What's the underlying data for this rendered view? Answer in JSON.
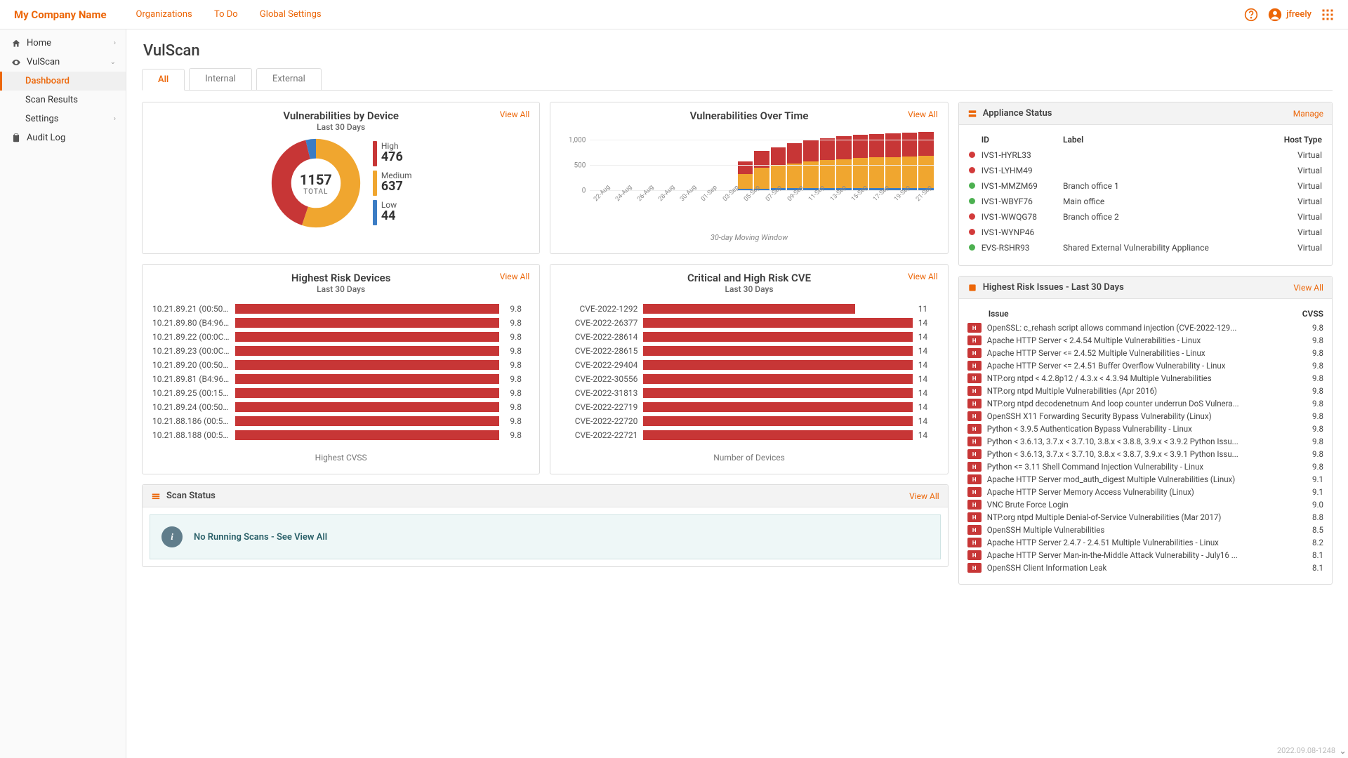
{
  "brand": "My Company Name",
  "topnav": {
    "organizations": "Organizations",
    "todo": "To Do",
    "global": "Global Settings"
  },
  "user": "jfreely",
  "sidebar": {
    "home": "Home",
    "vulscan": "VulScan",
    "dashboard": "Dashboard",
    "scan_results": "Scan Results",
    "settings": "Settings",
    "audit_log": "Audit Log"
  },
  "page_title": "VulScan",
  "tabs": {
    "all": "All",
    "internal": "Internal",
    "external": "External"
  },
  "view_all": "View All",
  "manage": "Manage",
  "donut": {
    "title": "Vulnerabilities by Device",
    "subtitle": "Last 30 Days",
    "total_label": "TOTAL",
    "total": "1157",
    "high_label": "High",
    "high": "476",
    "med_label": "Medium",
    "med": "637",
    "low_label": "Low",
    "low": "44",
    "colors": {
      "high": "#c73636",
      "med": "#f0a62f",
      "low": "#3b7cc4"
    }
  },
  "overtime": {
    "title": "Vulnerabilities Over Time",
    "subtitle": "30-day Moving Window",
    "ylim": 1300
  },
  "chart_data": {
    "type": "bar",
    "title": "Vulnerabilities Over Time",
    "subtitle": "30-day Moving Window",
    "ylabel": "",
    "y_ticks": [
      0,
      500,
      1000
    ],
    "ylim": [
      0,
      1300
    ],
    "categories": [
      "22-Aug",
      "24-Aug",
      "26-Aug",
      "28-Aug",
      "30-Aug",
      "01-Sep",
      "03-Sep",
      "05-Sep",
      "07-Sep",
      "09-Sep",
      "11-Sep",
      "13-Sep",
      "15-Sep",
      "17-Sep",
      "19-Sep",
      "21-Sep"
    ],
    "series": [
      {
        "name": "Low",
        "color": "#3b7cc4",
        "values": [
          0,
          0,
          0,
          0,
          0,
          0,
          0,
          0,
          0,
          28,
          32,
          36,
          36,
          40,
          40,
          42,
          42,
          44,
          44,
          44,
          44
        ]
      },
      {
        "name": "Medium",
        "color": "#f0a62f",
        "values": [
          0,
          0,
          0,
          0,
          0,
          0,
          0,
          0,
          0,
          300,
          420,
          460,
          500,
          540,
          560,
          580,
          600,
          610,
          620,
          630,
          637
        ]
      },
      {
        "name": "High",
        "color": "#c73636",
        "values": [
          0,
          0,
          0,
          0,
          0,
          0,
          0,
          0,
          0,
          240,
          330,
          360,
          400,
          420,
          440,
          450,
          460,
          464,
          468,
          472,
          476
        ]
      }
    ]
  },
  "risk_devices": {
    "title": "Highest Risk Devices",
    "subtitle": "Last 30 Days",
    "axis": "Highest CVSS",
    "rows": [
      {
        "label": "10.21.89.21 (00:50:5...",
        "v": "9.8"
      },
      {
        "label": "10.21.89.80 (B4:96:9...",
        "v": "9.8"
      },
      {
        "label": "10.21.89.22 (00:0C:2...",
        "v": "9.8"
      },
      {
        "label": "10.21.89.23 (00:0C:2...",
        "v": "9.8"
      },
      {
        "label": "10.21.89.20 (00:50:5...",
        "v": "9.8"
      },
      {
        "label": "10.21.89.81 (B4:96:9...",
        "v": "9.8"
      },
      {
        "label": "10.21.89.25 (00:15:5...",
        "v": "9.8"
      },
      {
        "label": "10.21.89.24 (00:50:5...",
        "v": "9.8"
      },
      {
        "label": "10.21.88.186 (00:50:...",
        "v": "9.8"
      },
      {
        "label": "10.21.88.188 (00:50:...",
        "v": "9.8"
      }
    ]
  },
  "cve": {
    "title": "Critical and High Risk CVE",
    "subtitle": "Last 30 Days",
    "axis": "Number of Devices",
    "max": 14,
    "rows": [
      {
        "label": "CVE-2022-1292",
        "v": "11"
      },
      {
        "label": "CVE-2022-26377",
        "v": "14"
      },
      {
        "label": "CVE-2022-28614",
        "v": "14"
      },
      {
        "label": "CVE-2022-28615",
        "v": "14"
      },
      {
        "label": "CVE-2022-29404",
        "v": "14"
      },
      {
        "label": "CVE-2022-30556",
        "v": "14"
      },
      {
        "label": "CVE-2022-31813",
        "v": "14"
      },
      {
        "label": "CVE-2022-22719",
        "v": "14"
      },
      {
        "label": "CVE-2022-22720",
        "v": "14"
      },
      {
        "label": "CVE-2022-22721",
        "v": "14"
      }
    ]
  },
  "appliance": {
    "title": "Appliance Status",
    "cols": {
      "id": "ID",
      "label": "Label",
      "host": "Host Type"
    },
    "rows": [
      {
        "dot": "#d23a3a",
        "id": "IVS1-HYRL33",
        "label": "",
        "host": "Virtual"
      },
      {
        "dot": "#d23a3a",
        "id": "IVS1-LYHM49",
        "label": "",
        "host": "Virtual"
      },
      {
        "dot": "#4cb050",
        "id": "IVS1-MMZM69",
        "label": "Branch office 1",
        "host": "Virtual"
      },
      {
        "dot": "#4cb050",
        "id": "IVS1-WBYF76",
        "label": "Main office",
        "host": "Virtual"
      },
      {
        "dot": "#d23a3a",
        "id": "IVS1-WWQG78",
        "label": "Branch office 2",
        "host": "Virtual"
      },
      {
        "dot": "#d23a3a",
        "id": "IVS1-WYNP46",
        "label": "",
        "host": "Virtual"
      },
      {
        "dot": "#4cb050",
        "id": "EVS-RSHR93",
        "label": "Shared External Vulnerability Appliance",
        "host": "Virtual"
      }
    ]
  },
  "issues": {
    "title": "Highest Risk Issues - Last 30 Days",
    "cols": {
      "issue": "Issue",
      "cvss": "CVSS"
    },
    "rows": [
      {
        "t": "OpenSSL: c_rehash script allows command injection (CVE-2022-129...",
        "s": "9.8"
      },
      {
        "t": "Apache HTTP Server < 2.4.54 Multiple Vulnerabilities - Linux",
        "s": "9.8"
      },
      {
        "t": "Apache HTTP Server <= 2.4.52 Multiple Vulnerabilities - Linux",
        "s": "9.8"
      },
      {
        "t": "Apache HTTP Server <= 2.4.51 Buffer Overflow Vulnerability - Linux",
        "s": "9.8"
      },
      {
        "t": "NTP.org ntpd < 4.2.8p12 / 4.3.x < 4.3.94 Multiple Vulnerabilities",
        "s": "9.8"
      },
      {
        "t": "NTP.org ntpd Multiple Vulnerabilities (Apr 2016)",
        "s": "9.8"
      },
      {
        "t": "NTP.org ntpd decodenetnum And loop counter underrun DoS Vulnera...",
        "s": "9.8"
      },
      {
        "t": "OpenSSH X11 Forwarding Security Bypass Vulnerability (Linux)",
        "s": "9.8"
      },
      {
        "t": "Python < 3.9.5 Authentication Bypass Vulnerability - Linux",
        "s": "9.8"
      },
      {
        "t": "Python < 3.6.13, 3.7.x < 3.7.10, 3.8.x < 3.8.8, 3.9.x < 3.9.2 Python Issu...",
        "s": "9.8"
      },
      {
        "t": "Python < 3.6.13, 3.7.x < 3.7.10, 3.8.x < 3.8.7, 3.9.x < 3.9.1 Python Issu...",
        "s": "9.8"
      },
      {
        "t": "Python <= 3.11 Shell Command Injection Vulnerability - Linux",
        "s": "9.8"
      },
      {
        "t": "Apache HTTP Server mod_auth_digest Multiple Vulnerabilities (Linux)",
        "s": "9.1"
      },
      {
        "t": "Apache HTTP Server Memory Access Vulnerability (Linux)",
        "s": "9.1"
      },
      {
        "t": "VNC Brute Force Login",
        "s": "9.0"
      },
      {
        "t": "NTP.org ntpd Multiple Denial-of-Service Vulnerabilities (Mar 2017)",
        "s": "8.8"
      },
      {
        "t": "OpenSSH Multiple Vulnerabilities",
        "s": "8.5"
      },
      {
        "t": "Apache HTTP Server 2.4.7 - 2.4.51 Multiple Vulnerabilities - Linux",
        "s": "8.2"
      },
      {
        "t": "Apache HTTP Server Man-in-the-Middle Attack Vulnerability - July16 ...",
        "s": "8.1"
      },
      {
        "t": "OpenSSH Client Information Leak",
        "s": "8.1"
      }
    ]
  },
  "scan_status": {
    "title": "Scan Status",
    "msg": "No Running Scans - See View All"
  },
  "footer_version": "2022.09.08-1248"
}
